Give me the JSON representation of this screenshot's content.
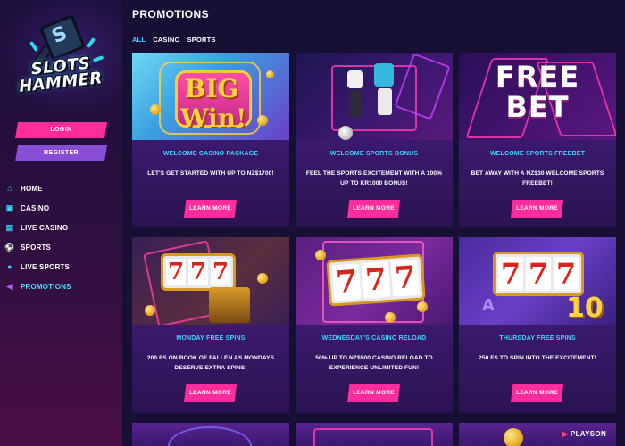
{
  "logo": {
    "line1": "SLOTS",
    "line2": "HAMMER"
  },
  "auth": {
    "login_label": "LOGIN",
    "register_label": "REGISTER"
  },
  "nav": {
    "items": [
      {
        "label": "HOME",
        "icon": "home-icon"
      },
      {
        "label": "CASINO",
        "icon": "casino-icon"
      },
      {
        "label": "LIVE CASINO",
        "icon": "live-casino-icon"
      },
      {
        "label": "SPORTS",
        "icon": "sports-icon"
      },
      {
        "label": "LIVE SPORTS",
        "icon": "live-sports-icon"
      },
      {
        "label": "PROMOTIONS",
        "icon": "promotions-icon",
        "active": true
      }
    ]
  },
  "page": {
    "title": "PROMOTIONS",
    "tabs": [
      {
        "label": "ALL",
        "active": true
      },
      {
        "label": "CASINO"
      },
      {
        "label": "SPORTS"
      }
    ]
  },
  "promotions": [
    {
      "art_text": "BIG Win!",
      "title": "WELCOME CASINO PACKAGE",
      "description": "LET'S GET STARTED WITH UP TO NZ$1700!",
      "button": "LEARN MORE"
    },
    {
      "art_text": "",
      "title": "WELCOME SPORTS BONUS",
      "description": "FEEL THE SPORTS EXCITEMENT WITH A 100% UP TO KR1000 BONUS!",
      "button": "LEARN MORE"
    },
    {
      "art_text": "FREE BET",
      "title": "WELCOME SPORTS FREEBET",
      "description": "BET AWAY WITH A NZ$30 WELCOME SPORTS FREEBET!",
      "button": "LEARN MORE"
    },
    {
      "art_text": "777",
      "title": "MONDAY FREE SPINS",
      "description": "200 FS ON BOOK OF FALLEN AS MONDAYS DESERVE EXTRA SPINS!",
      "button": "LEARN MORE"
    },
    {
      "art_text": "77",
      "title": "WEDNESDAY'S CASINO RELOAD",
      "description": "50% UP TO NZ$500 CASINO RELOAD TO EXPERIENCE UNLIMITED FUN!",
      "button": "LEARN MORE"
    },
    {
      "art_text": "777",
      "title": "THURSDAY FREE SPINS",
      "description": "250 FS TO SPIN INTO THE EXCITEMENT!",
      "button": "LEARN MORE"
    }
  ],
  "partial_row": {
    "provider_badge": "PLAYSON"
  },
  "colors": {
    "accent_pink": "#ff2d9b",
    "accent_cyan": "#3fd4ff",
    "register_purple": "#8a4ed6",
    "card_bg": "#3a1a6c",
    "page_bg": "#180f34"
  }
}
